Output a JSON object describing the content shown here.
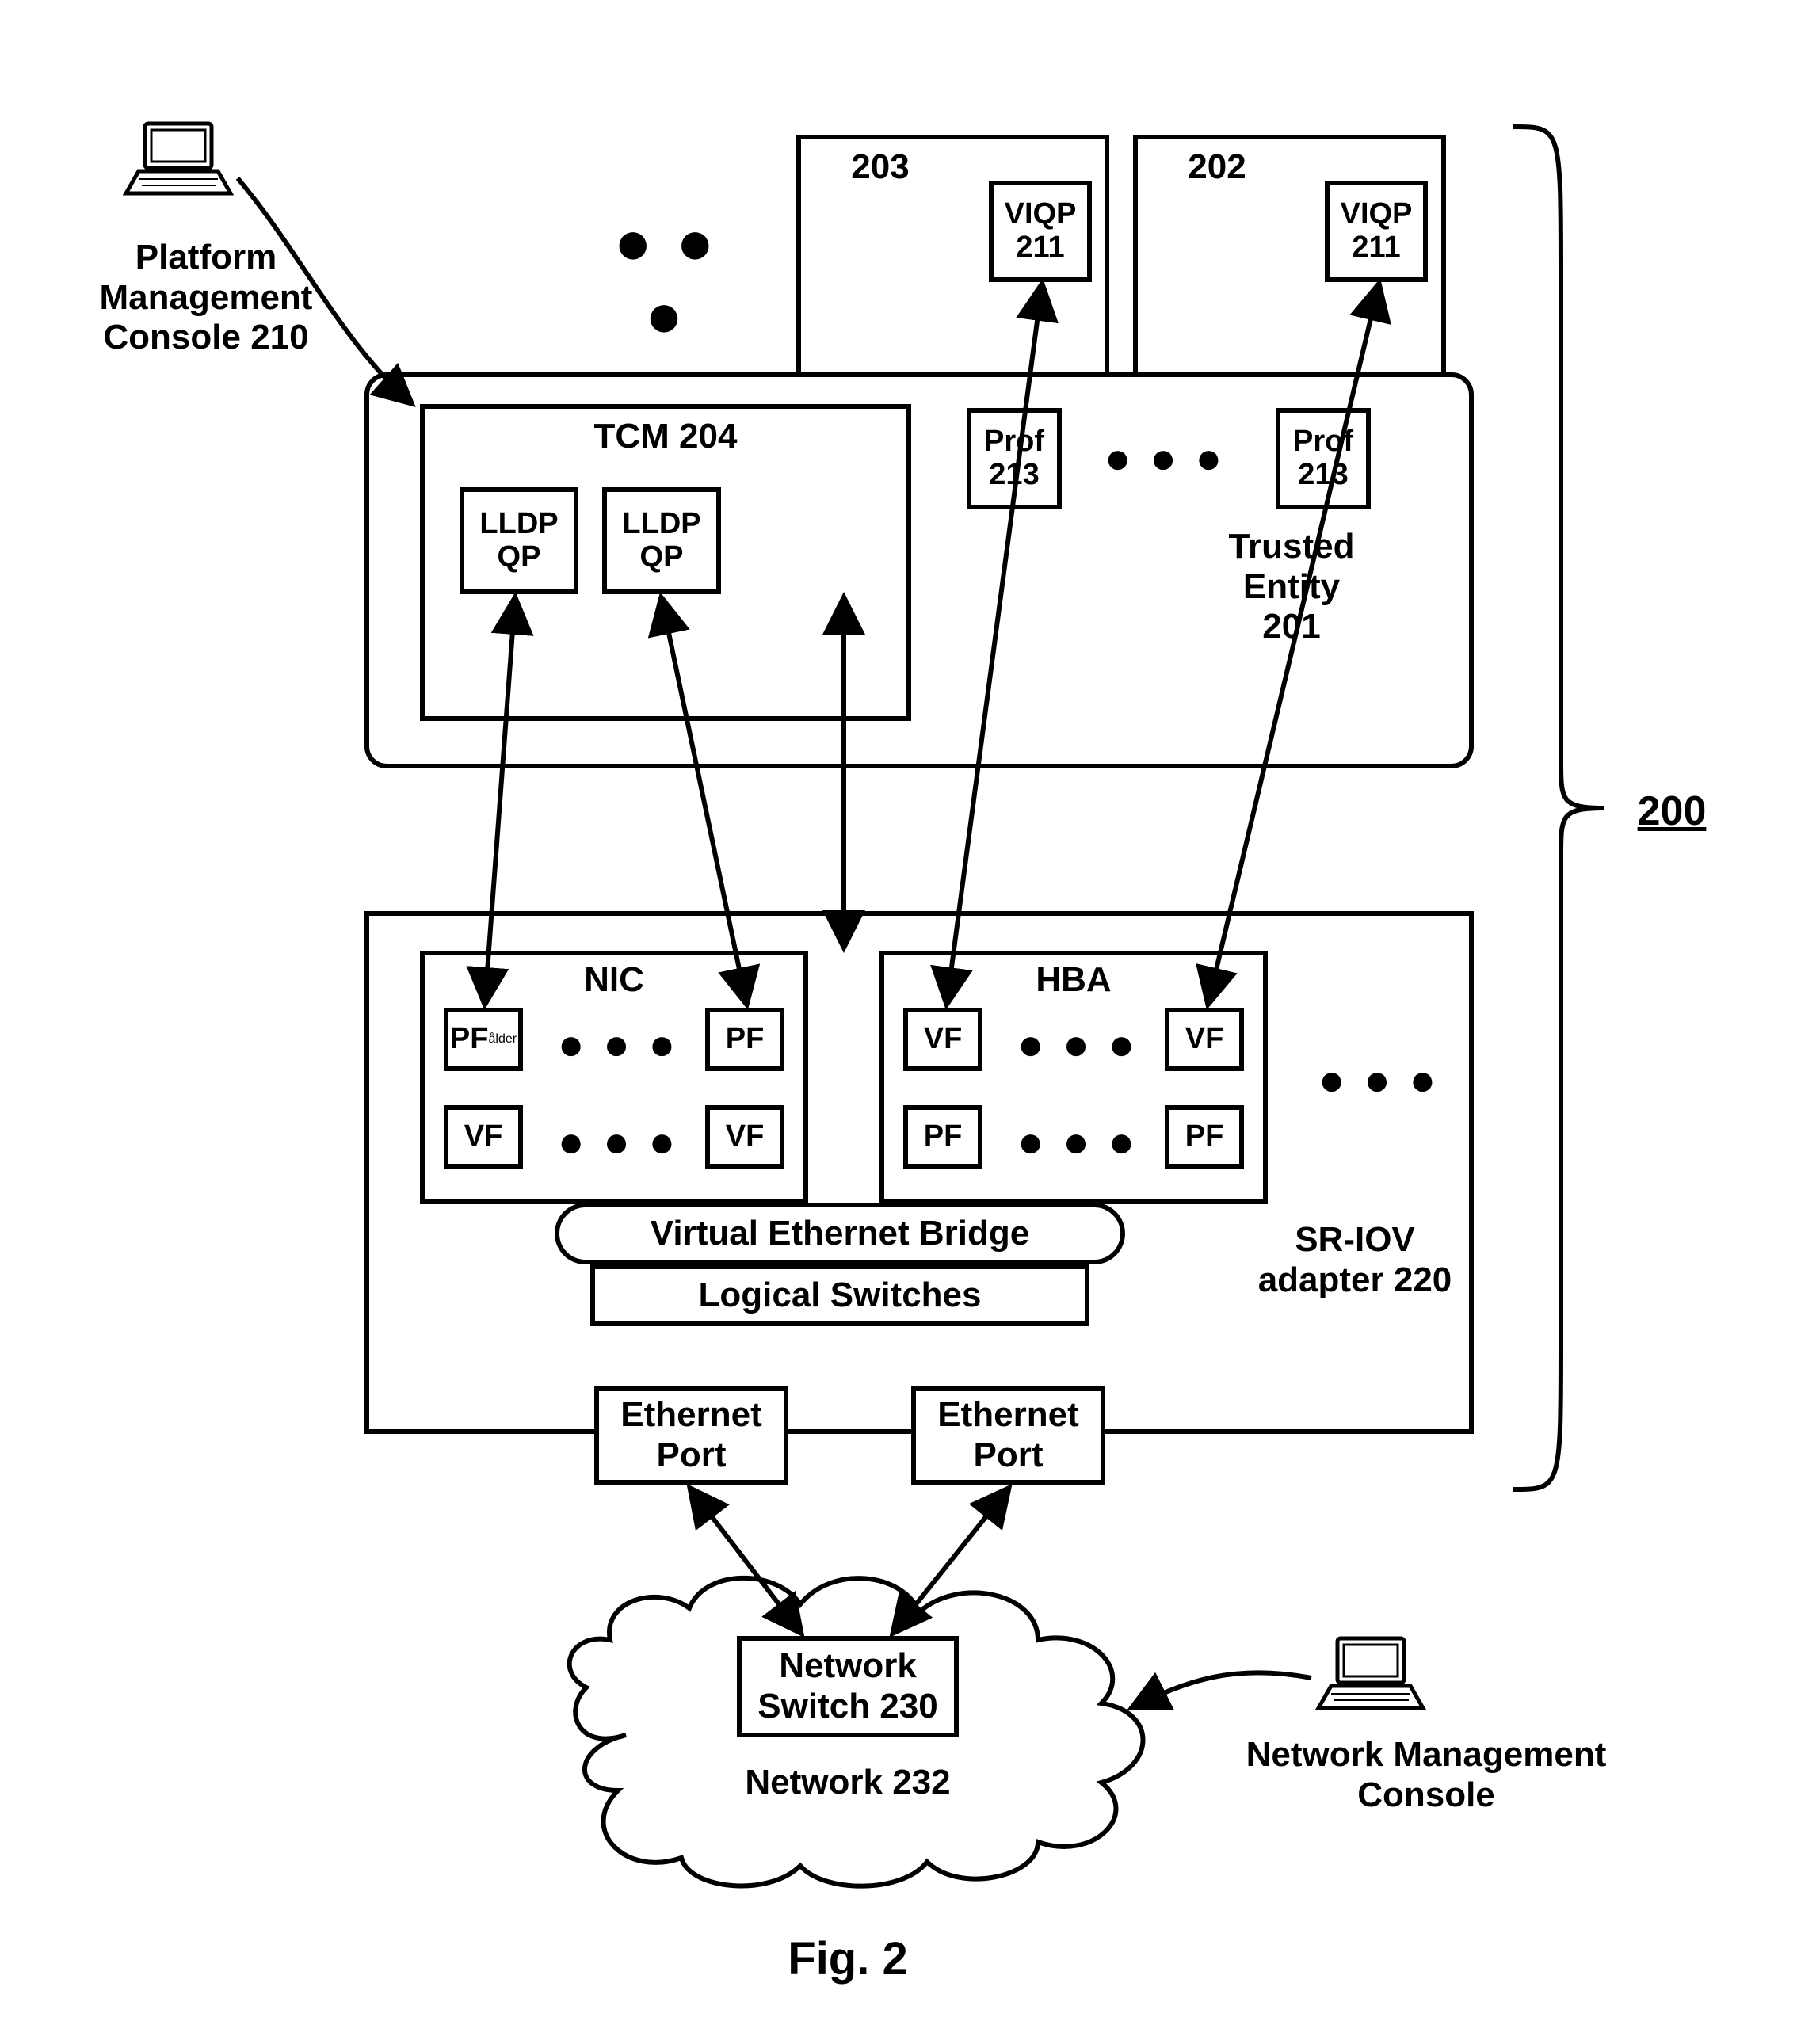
{
  "figure_caption": "Fig. 2",
  "system_ref": "200",
  "platform_console": {
    "label": "Platform\nManagement\nConsole 210"
  },
  "network_console": {
    "label": "Network Management\nConsole"
  },
  "partitions": {
    "p203": {
      "id": "203",
      "viqp": "VIQP\n211"
    },
    "p202": {
      "id": "202",
      "viqp": "VIQP\n211"
    }
  },
  "trusted_entity": {
    "label": "Trusted\nEntity\n201",
    "tcm": {
      "label": "TCM 204",
      "lldp1": "LLDP\nQP",
      "lldp2": "LLDP\nQP"
    },
    "prof_a": "Prof\n213",
    "prof_b": "Prof\n213"
  },
  "adapter": {
    "label": "SR-IOV\nadapter 220",
    "nic": {
      "label": "NIC",
      "pf": "PF",
      "vf": "VF"
    },
    "hba": {
      "label": "HBA",
      "pf": "PF",
      "vf": "VF"
    },
    "veb": "Virtual Ethernet Bridge",
    "lsw": "Logical Switches",
    "eport": "Ethernet\nPort"
  },
  "network": {
    "switch": "Network\nSwitch 230",
    "label": "Network 232"
  }
}
